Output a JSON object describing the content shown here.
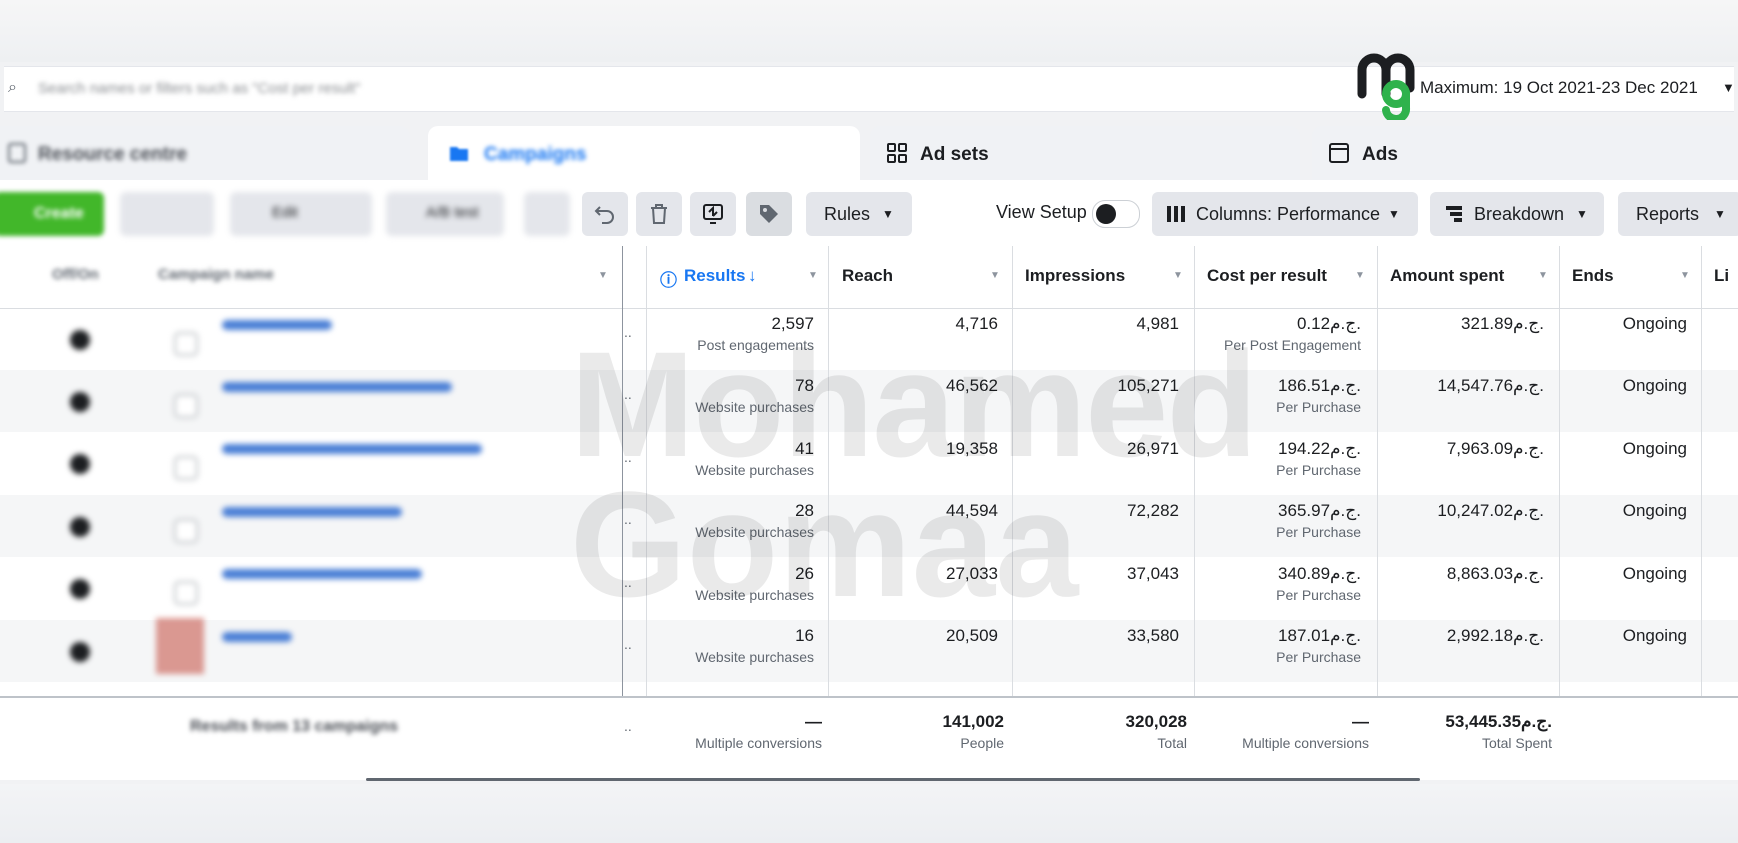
{
  "search": {
    "placeholder": "Search names or filters such as \"Cost per result\""
  },
  "date_range": "Maximum: 19 Oct 2021-23 Dec 2021",
  "tabs": [
    {
      "label": "Resource centre"
    },
    {
      "label": "Campaigns"
    },
    {
      "label": "Ad sets"
    },
    {
      "label": "Ads"
    }
  ],
  "toolbar": {
    "create_label": "Create",
    "edit_label": "Edit",
    "ab_test_label": "A/B test",
    "rules_label": "Rules",
    "view_setup_label": "View Setup",
    "columns_label": "Columns: Performance",
    "breakdown_label": "Breakdown",
    "reports_label": "Reports"
  },
  "table": {
    "headers": {
      "off_on": "Off/On",
      "campaign_name": "Campaign name",
      "results": "Results",
      "reach": "Reach",
      "impressions": "Impressions",
      "cost_per_result": "Cost per result",
      "amount_spent": "Amount spent",
      "ends": "Ends",
      "li": "Li"
    },
    "rows": [
      {
        "results": "2,597",
        "results_type": "Post engagements",
        "reach": "4,716",
        "impressions": "4,981",
        "cost": "0.12ج.م.",
        "cost_type": "Per Post Engagement",
        "spent": "321.89ج.م.",
        "ends": "Ongoing"
      },
      {
        "results": "78",
        "results_type": "Website purchases",
        "reach": "46,562",
        "impressions": "105,271",
        "cost": "186.51ج.م.",
        "cost_type": "Per Purchase",
        "spent": "14,547.76ج.م.",
        "ends": "Ongoing"
      },
      {
        "results": "41",
        "results_type": "Website purchases",
        "reach": "19,358",
        "impressions": "26,971",
        "cost": "194.22ج.م.",
        "cost_type": "Per Purchase",
        "spent": "7,963.09ج.م.",
        "ends": "Ongoing"
      },
      {
        "results": "28",
        "results_type": "Website purchases",
        "reach": "44,594",
        "impressions": "72,282",
        "cost": "365.97ج.م.",
        "cost_type": "Per Purchase",
        "spent": "10,247.02ج.م.",
        "ends": "Ongoing"
      },
      {
        "results": "26",
        "results_type": "Website purchases",
        "reach": "27,033",
        "impressions": "37,043",
        "cost": "340.89ج.م.",
        "cost_type": "Per Purchase",
        "spent": "8,863.03ج.م.",
        "ends": "Ongoing"
      },
      {
        "results": "16",
        "results_type": "Website purchases",
        "reach": "20,509",
        "impressions": "33,580",
        "cost": "187.01ج.م.",
        "cost_type": "Per Purchase",
        "spent": "2,992.18ج.م.",
        "ends": "Ongoing"
      }
    ],
    "footer": {
      "label": "Results from 13 campaigns",
      "results": "—",
      "results_type": "Multiple conversions",
      "reach": "141,002",
      "reach_type": "People",
      "impressions": "320,028",
      "impressions_type": "Total",
      "cost": "—",
      "cost_type": "Multiple conversions",
      "spent": "53,445.35ج.م.",
      "spent_type": "Total Spent"
    }
  },
  "watermark": {
    "line1": "Mohamed",
    "line2": "Gomaa"
  },
  "colors": {
    "accent": "#1877f2",
    "create_green": "#42b72a",
    "logo_green": "#2fb24c"
  }
}
